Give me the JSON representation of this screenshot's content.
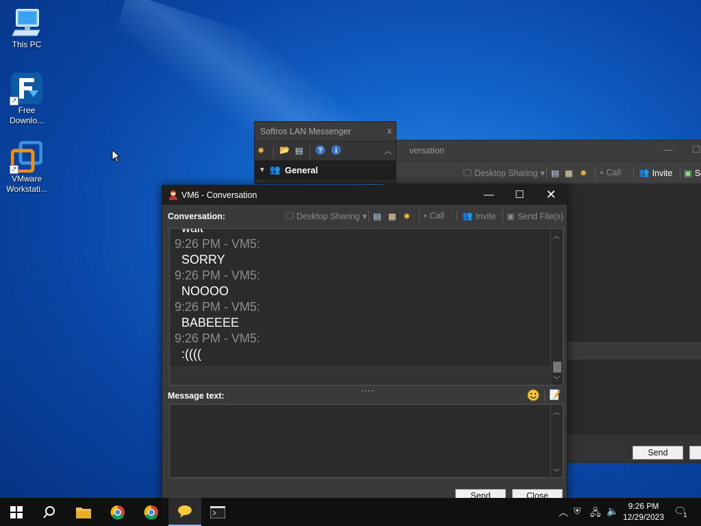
{
  "desktop": {
    "icons": [
      {
        "label": "This PC"
      },
      {
        "label": "Free Downlo..."
      },
      {
        "label": "VMware Workstati..."
      }
    ]
  },
  "background_window": {
    "title_fragment": "versation",
    "tools": [
      "Desktop Sharing",
      "Call",
      "Invite",
      "Se"
    ],
    "send_label": "Send"
  },
  "messenger_window": {
    "title": "Softros LAN Messenger",
    "close": "x",
    "group_name": "General"
  },
  "conversation_window": {
    "title": "VM6 - Conversation",
    "conversation_label": "Conversation:",
    "toolbar": {
      "desktop_sharing": "Desktop Sharing",
      "call": "Call",
      "invite": "Invite",
      "send_files": "Send File(s)"
    },
    "messages": [
      {
        "body": "wait"
      },
      {
        "head": "9:26 PM - VM5:",
        "body": "SORRY"
      },
      {
        "head": "9:26 PM - VM5:",
        "body": "NOOOO"
      },
      {
        "head": "9:26 PM - VM5:",
        "body": "BABEEEE"
      },
      {
        "head": "9:26 PM - VM5:",
        "body": ":(((("
      }
    ],
    "message_text_label": "Message text:",
    "message_value": "",
    "send_label": "Send",
    "close_label": "Close"
  },
  "taskbar": {
    "time": "9:26 PM",
    "date": "12/29/2023",
    "notification_count": "1"
  },
  "colors": {
    "desktop_blue": "#0a5fd0",
    "chrome_red": "#db4437",
    "chrome_green": "#0f9d58",
    "chrome_yellow": "#f4b400",
    "folder_yellow": "#f2c14e"
  }
}
